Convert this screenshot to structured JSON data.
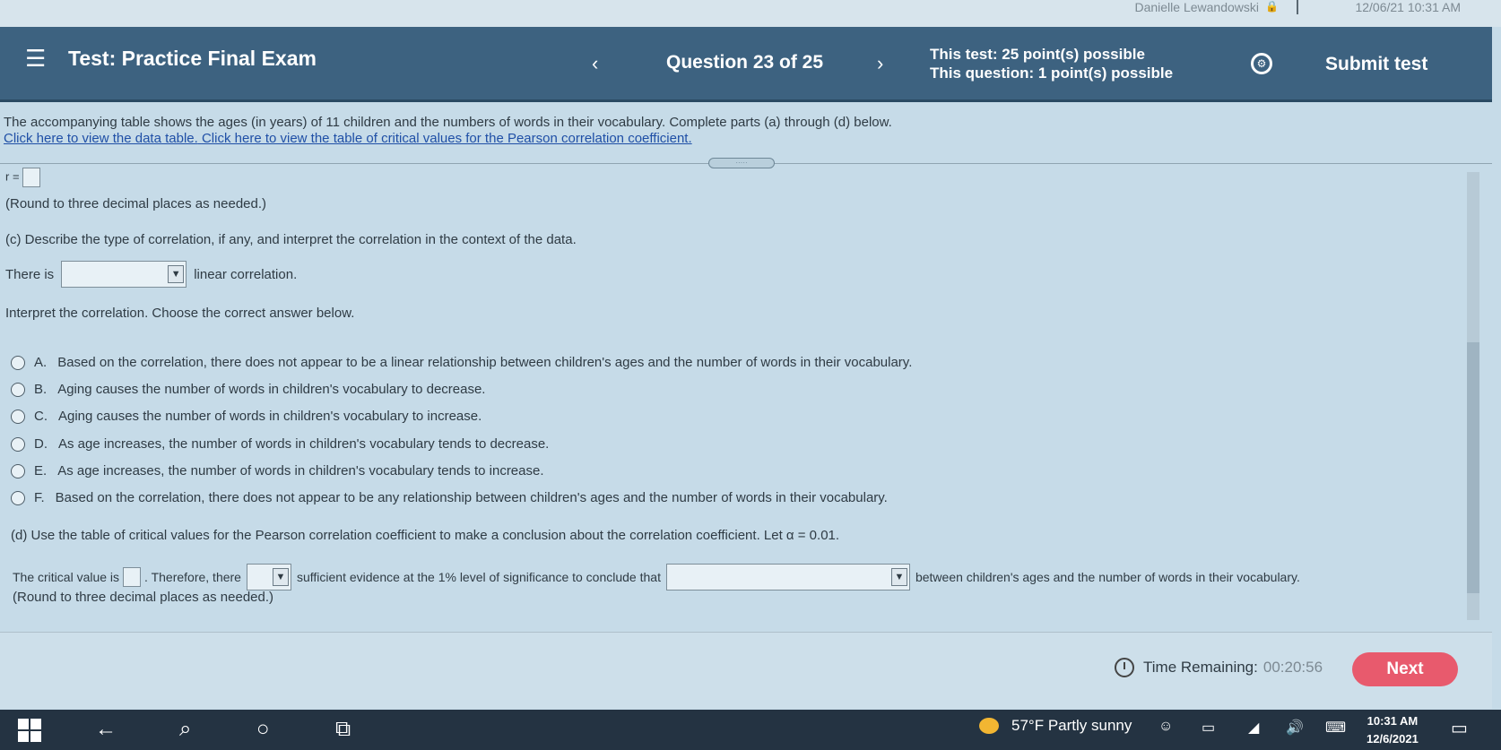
{
  "top_strip": {
    "user": "Danielle Lewandowski",
    "datetime": "12/06/21 10:31 AM"
  },
  "header": {
    "menu_icon": "hamburger-icon",
    "title": "Test: Practice Final Exam",
    "prev_icon": "‹",
    "question_counter": "Question 23 of 25",
    "next_icon": "›",
    "test_points": "This test: 25 point(s) possible",
    "question_points": "This question: 1 point(s) possible",
    "settings_icon": "gear-icon",
    "submit_label": "Submit test"
  },
  "intro": {
    "text": "The accompanying table shows the ages (in years) of 11 children and the numbers of words in their vocabulary. Complete parts (a) through (d) below.",
    "link1": "Click here to view the data table.",
    "link2": "Click here to view the table of critical values for the Pearson correlation coefficient."
  },
  "grip_label": "·····",
  "part_b": {
    "r_label": "r =",
    "round_note": "(Round to three decimal places as needed.)"
  },
  "part_c": {
    "prompt": "(c) Describe the type of correlation, if any, and interpret the correlation in the context of the data.",
    "there_is": "There is",
    "linear_correlation": "linear correlation.",
    "interpret_prompt": "Interpret the correlation. Choose the correct answer below.",
    "options": [
      {
        "letter": "A.",
        "text": "Based on the correlation, there does not appear to be a linear relationship between children's ages and the number of words in their vocabulary."
      },
      {
        "letter": "B.",
        "text": "Aging causes the number of words in children's vocabulary to decrease."
      },
      {
        "letter": "C.",
        "text": "Aging causes the number of words in children's vocabulary to increase."
      },
      {
        "letter": "D.",
        "text": "As age increases, the number of words in children's vocabulary tends to decrease."
      },
      {
        "letter": "E.",
        "text": "As age increases, the number of words in children's vocabulary tends to increase."
      },
      {
        "letter": "F.",
        "text": "Based on the correlation, there does not appear to be any relationship between children's ages and the number of words in their vocabulary."
      }
    ]
  },
  "part_d": {
    "prompt": "(d) Use the table of critical values for the Pearson correlation coefficient to make a conclusion about the correlation coefficient. Let α = 0.01.",
    "critical_value_label": "The critical value is",
    "therefore_there": ". Therefore, there",
    "sufficient_text": "sufficient evidence at the 1% level of significance to conclude that",
    "between_text": "between children's ages and the number of words in their vocabulary.",
    "round_note": "(Round to three decimal places as needed.)"
  },
  "footer": {
    "timer_icon": "clock-icon",
    "timer_label": "Time Remaining:",
    "timer_value": "00:20:56",
    "next_label": "Next"
  },
  "taskbar": {
    "weather_icon": "partly-sunny-icon",
    "weather": "57°F  Partly sunny",
    "time": "10:31 AM",
    "date": "12/6/2021"
  }
}
